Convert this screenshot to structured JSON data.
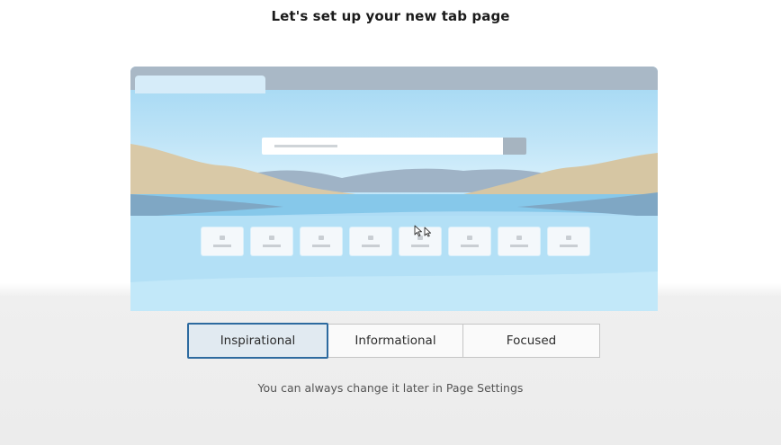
{
  "header": {
    "title": "Let's set up your new tab page"
  },
  "preview": {
    "tile_count": 8,
    "icons": [
      "search-box",
      "search-button",
      "quick-link-tile",
      "mouse-cursor-icon"
    ],
    "colors": {
      "sky": "#bfe4f7",
      "tabstrip": "#a9b8c6",
      "hills": "#d8c9a8",
      "water": "#a9daf4"
    }
  },
  "layout_options": [
    {
      "label": "Inspirational",
      "selected": true
    },
    {
      "label": "Informational",
      "selected": false
    },
    {
      "label": "Focused",
      "selected": false
    }
  ],
  "hint": "You can always change it later in Page Settings",
  "colors": {
    "selected_border": "#2d6a9f",
    "selected_fill": "#e1eaf1"
  }
}
